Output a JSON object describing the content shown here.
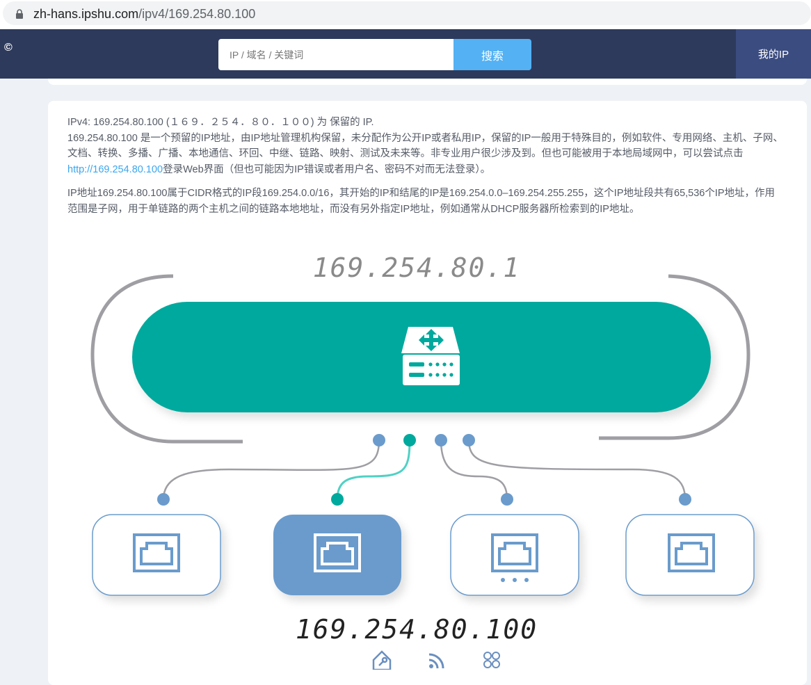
{
  "browser": {
    "url_host": "zh-hans.ipshu.com",
    "url_path": "/ipv4/169.254.80.100"
  },
  "header": {
    "logo": "©",
    "search_placeholder": "IP / 域名 / 关键词",
    "search_button": "搜索",
    "myip_button": "我的IP"
  },
  "content": {
    "line1": "IPv4: 169.254.80.100 (１６９．２５４．８０．１００) 为 保留的 IP.",
    "para1_before_link": "169.254.80.100 是一个预留的IP地址，由IP地址管理机构保留，未分配作为公开IP或者私用IP，保留的IP一般用于特殊目的，例如软件、专用网络、主机、子网、文档、转换、多播、广播、本地通信、环回、中继、链路、映射、测试及未来等。非专业用户很少涉及到。但也可能被用于本地局域网中，可以尝试点击",
    "para1_link": "http://169.254.80.100",
    "para1_after_link": "登录Web界面（但也可能因为IP错误或者用户名、密码不对而无法登录）。",
    "para2": "IP地址169.254.80.100属于CIDR格式的IP段169.254.0.0/16，其开始的IP和结尾的IP是169.254.0.0–169.254.255.255，这个IP地址段共有65,536个IP地址，作用范围是子网，用于单链路的两个主机之间的链路本地地址，而没有另外指定IP地址，例如通常从DHCP服务器所检索到的IP地址。"
  },
  "diagram": {
    "gateway_ip": "169.254.80.1",
    "host_ip": "169.254.80.100",
    "colors": {
      "router": "#00a99d",
      "port_blue": "#6a9bcc",
      "active_node": "#6a9bcc",
      "arc_gray": "#9e9ea3",
      "active_line": "#4fd1c5"
    },
    "icons": [
      "router-icon",
      "ethernet-port-icon",
      "settings-icon",
      "rss-icon",
      "command-icon"
    ]
  }
}
